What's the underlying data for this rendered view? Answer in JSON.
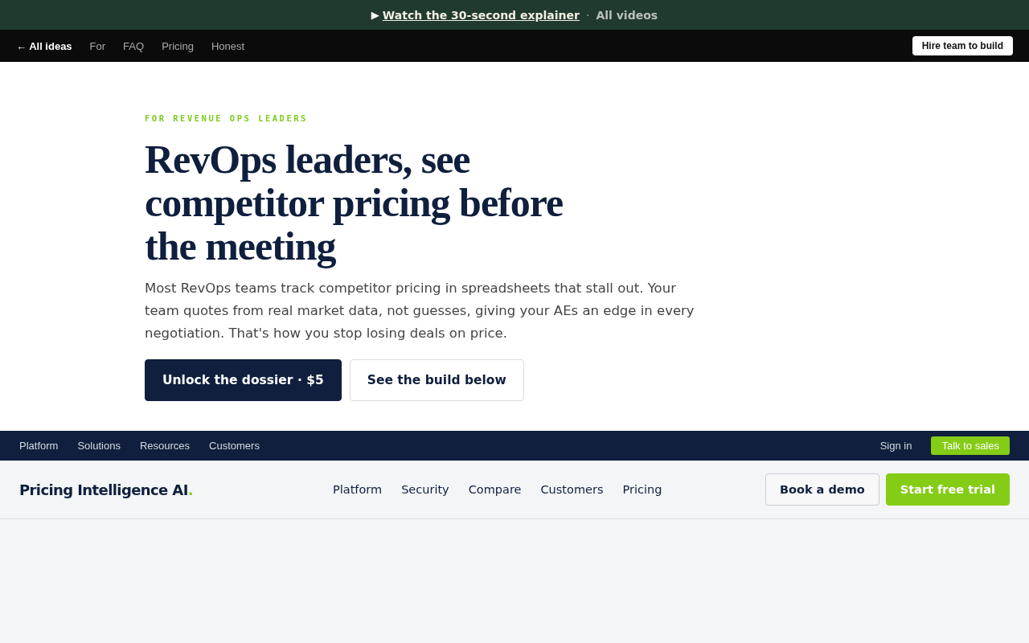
{
  "announcement": {
    "play": "▶",
    "link": "Watch the 30-second explainer",
    "separator": "·",
    "secondary": "All videos"
  },
  "topnav": {
    "back": "← All ideas",
    "links": [
      "For",
      "FAQ",
      "Pricing",
      "Honest"
    ],
    "cta": "Hire team to build"
  },
  "hero": {
    "eyebrow": "FOR REVENUE OPS LEADERS",
    "title": "RevOps leaders, see competitor pricing before the meeting",
    "body": "Most RevOps teams track competitor pricing in spreadsheets that stall out. Your team quotes from real market data, not guesses, giving your AEs an edge in every negotiation. That's how you stop losing deals on price.",
    "buttons": [
      {
        "kind": "primary",
        "label": "Unlock the dossier · $5"
      },
      {
        "kind": "secondary",
        "label": "See the build below"
      }
    ]
  },
  "utility_bar": {
    "links": [
      "Platform",
      "Solutions",
      "Resources",
      "Customers"
    ],
    "sign_in": "Sign in",
    "cta": "Talk to sales"
  },
  "site_header": {
    "logo": "Pricing Intelligence AI",
    "logo_mark": ".",
    "links": [
      "Platform",
      "Security",
      "Compare",
      "Customers",
      "Pricing"
    ],
    "buttons": [
      {
        "kind": "secondary",
        "label": "Book a demo"
      },
      {
        "kind": "primary",
        "label": "Start free trial"
      }
    ]
  }
}
